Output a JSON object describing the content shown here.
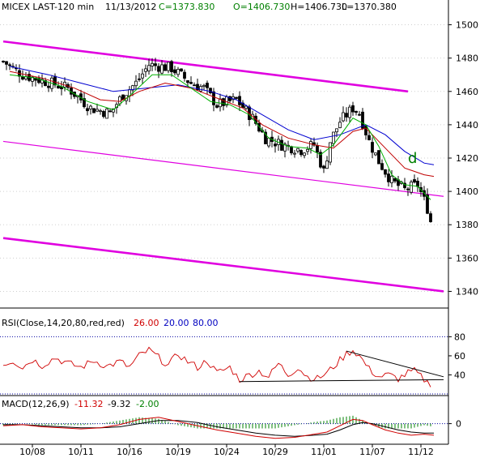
{
  "header": {
    "symbol": "MICEX LAST-120 min",
    "date": "11/13/2012",
    "close": "C=1373.830",
    "open": "O=1406.730",
    "high": "H=1406.730",
    "low": "L=1370.380"
  },
  "annotation_letter": "d",
  "rsi_header": {
    "label": "RSI(Close,14,20,80,red,red)",
    "value": "26.00",
    "lower": "20.00",
    "upper": "80.00"
  },
  "macd_header": {
    "label": "MACD(12,26,9)",
    "macd": "-11.32",
    "signal": "-9.32",
    "hist": "-2.00"
  },
  "colors": {
    "up_candle": "#ffffff",
    "down_candle": "#000000",
    "ma_fast": "#00b000",
    "ma_mid": "#c00000",
    "ma_slow": "#0000d0",
    "channel": "#e000e0",
    "rsi_line": "#d00000",
    "rsi_value": "#d00000",
    "rsi_lower": "#0000c0",
    "rsi_upper": "#0000c0",
    "macd_value": "#d00000",
    "signal_value": "#000000",
    "hist_value": "#008000",
    "grid_dots": "#0000a0",
    "annotation": "#008000"
  },
  "chart_data": [
    {
      "type": "candlestick",
      "panel": "price",
      "x_tick_labels": [
        "10/08",
        "10/11",
        "10/16",
        "10/19",
        "10/24",
        "10/29",
        "11/01",
        "11/07",
        "11/12"
      ],
      "y_tick_labels": [
        "1500",
        "1480",
        "1460",
        "1440",
        "1420",
        "1400",
        "1380",
        "1360",
        "1340"
      ],
      "ylim": [
        1330,
        1510
      ],
      "n_bars": 133,
      "close_path": [
        [
          0,
          1478
        ],
        [
          6,
          1470
        ],
        [
          13,
          1466
        ],
        [
          20,
          1462
        ],
        [
          27,
          1450
        ],
        [
          33,
          1447
        ],
        [
          37,
          1458
        ],
        [
          41,
          1465
        ],
        [
          45,
          1476
        ],
        [
          52,
          1474
        ],
        [
          58,
          1465
        ],
        [
          62,
          1462
        ],
        [
          66,
          1452
        ],
        [
          72,
          1455
        ],
        [
          77,
          1444
        ],
        [
          81,
          1432
        ],
        [
          86,
          1428
        ],
        [
          92,
          1425
        ],
        [
          96,
          1428
        ],
        [
          99,
          1412
        ],
        [
          101,
          1430
        ],
        [
          104,
          1442
        ],
        [
          108,
          1450
        ],
        [
          110,
          1447
        ],
        [
          113,
          1430
        ],
        [
          116,
          1418
        ],
        [
          120,
          1406
        ],
        [
          124,
          1401
        ],
        [
          128,
          1404
        ],
        [
          131,
          1390
        ],
        [
          133,
          1374
        ]
      ],
      "ma_fast_path": [
        [
          2,
          1470
        ],
        [
          10,
          1468
        ],
        [
          18,
          1463
        ],
        [
          26,
          1454
        ],
        [
          34,
          1449
        ],
        [
          40,
          1459
        ],
        [
          46,
          1470
        ],
        [
          52,
          1470
        ],
        [
          58,
          1462
        ],
        [
          64,
          1454
        ],
        [
          70,
          1452
        ],
        [
          76,
          1446
        ],
        [
          82,
          1432
        ],
        [
          88,
          1427
        ],
        [
          94,
          1426
        ],
        [
          98,
          1422
        ],
        [
          102,
          1428
        ],
        [
          108,
          1444
        ],
        [
          112,
          1440
        ],
        [
          116,
          1427
        ],
        [
          120,
          1410
        ],
        [
          124,
          1404
        ],
        [
          128,
          1403
        ],
        [
          132,
          1395
        ]
      ],
      "ma_mid_path": [
        [
          2,
          1472
        ],
        [
          12,
          1468
        ],
        [
          22,
          1462
        ],
        [
          30,
          1455
        ],
        [
          36,
          1454
        ],
        [
          42,
          1460
        ],
        [
          50,
          1465
        ],
        [
          58,
          1462
        ],
        [
          66,
          1456
        ],
        [
          74,
          1450
        ],
        [
          80,
          1440
        ],
        [
          88,
          1432
        ],
        [
          96,
          1428
        ],
        [
          102,
          1426
        ],
        [
          108,
          1436
        ],
        [
          112,
          1438
        ],
        [
          118,
          1426
        ],
        [
          124,
          1414
        ],
        [
          130,
          1410
        ],
        [
          133,
          1409
        ]
      ],
      "ma_slow_path": [
        [
          2,
          1475
        ],
        [
          14,
          1470
        ],
        [
          24,
          1465
        ],
        [
          34,
          1460
        ],
        [
          44,
          1462
        ],
        [
          54,
          1464
        ],
        [
          64,
          1460
        ],
        [
          72,
          1455
        ],
        [
          80,
          1446
        ],
        [
          88,
          1437
        ],
        [
          96,
          1431
        ],
        [
          104,
          1434
        ],
        [
          112,
          1440
        ],
        [
          118,
          1434
        ],
        [
          124,
          1424
        ],
        [
          130,
          1417
        ],
        [
          133,
          1416
        ]
      ],
      "channel_lines": [
        [
          [
            0,
            1490
          ],
          [
            125,
            1460
          ]
        ],
        [
          [
            0,
            1430
          ],
          [
            136,
            1397
          ]
        ],
        [
          [
            0,
            1372
          ],
          [
            136,
            1340
          ]
        ]
      ]
    },
    {
      "type": "line",
      "panel": "rsi",
      "y_tick_labels": [
        "80",
        "60",
        "40"
      ],
      "ylim": [
        20,
        88
      ],
      "reference_levels": [
        20,
        80
      ],
      "rsi_path": [
        [
          0,
          51
        ],
        [
          3,
          55
        ],
        [
          6,
          48
        ],
        [
          9,
          56
        ],
        [
          12,
          50
        ],
        [
          16,
          58
        ],
        [
          20,
          52
        ],
        [
          24,
          48
        ],
        [
          28,
          55
        ],
        [
          32,
          49
        ],
        [
          36,
          54
        ],
        [
          39,
          48
        ],
        [
          42,
          60
        ],
        [
          45,
          66
        ],
        [
          48,
          58
        ],
        [
          51,
          50
        ],
        [
          54,
          62
        ],
        [
          57,
          54
        ],
        [
          60,
          48
        ],
        [
          63,
          55
        ],
        [
          66,
          42
        ],
        [
          70,
          48
        ],
        [
          73,
          35
        ],
        [
          76,
          40
        ],
        [
          79,
          44
        ],
        [
          82,
          38
        ],
        [
          85,
          52
        ],
        [
          88,
          40
        ],
        [
          91,
          48
        ],
        [
          94,
          38
        ],
        [
          97,
          36
        ],
        [
          100,
          42
        ],
        [
          103,
          52
        ],
        [
          106,
          62
        ],
        [
          108,
          66
        ],
        [
          110,
          60
        ],
        [
          113,
          46
        ],
        [
          116,
          38
        ],
        [
          119,
          40
        ],
        [
          122,
          36
        ],
        [
          125,
          42
        ],
        [
          127,
          44
        ],
        [
          129,
          38
        ],
        [
          131,
          32
        ],
        [
          133,
          30
        ]
      ],
      "trend_lines": [
        [
          [
            73,
            33
          ],
          [
            136,
            35
          ]
        ],
        [
          [
            106,
            65
          ],
          [
            136,
            38
          ]
        ]
      ]
    },
    {
      "type": "line",
      "panel": "macd",
      "y_tick_labels": [
        "0"
      ],
      "ylim": [
        -18,
        12
      ],
      "macd_path": [
        [
          0,
          -2
        ],
        [
          6,
          -1
        ],
        [
          12,
          -3
        ],
        [
          18,
          -4
        ],
        [
          24,
          -5
        ],
        [
          30,
          -4
        ],
        [
          36,
          -1
        ],
        [
          42,
          4
        ],
        [
          48,
          6
        ],
        [
          54,
          2
        ],
        [
          60,
          -2
        ],
        [
          66,
          -6
        ],
        [
          72,
          -9
        ],
        [
          78,
          -12
        ],
        [
          84,
          -14
        ],
        [
          90,
          -13
        ],
        [
          96,
          -10
        ],
        [
          100,
          -8
        ],
        [
          104,
          -2
        ],
        [
          108,
          4
        ],
        [
          111,
          3
        ],
        [
          114,
          -1
        ],
        [
          118,
          -6
        ],
        [
          122,
          -9
        ],
        [
          126,
          -11
        ],
        [
          130,
          -10
        ],
        [
          133,
          -11
        ]
      ],
      "signal_path": [
        [
          0,
          -1
        ],
        [
          6,
          -1
        ],
        [
          12,
          -2
        ],
        [
          18,
          -3
        ],
        [
          24,
          -4
        ],
        [
          30,
          -4
        ],
        [
          36,
          -3
        ],
        [
          42,
          0
        ],
        [
          48,
          3
        ],
        [
          54,
          3
        ],
        [
          60,
          1
        ],
        [
          66,
          -3
        ],
        [
          72,
          -6
        ],
        [
          78,
          -9
        ],
        [
          84,
          -11
        ],
        [
          90,
          -12
        ],
        [
          96,
          -11
        ],
        [
          100,
          -10
        ],
        [
          104,
          -6
        ],
        [
          108,
          -1
        ],
        [
          111,
          1
        ],
        [
          114,
          0
        ],
        [
          118,
          -3
        ],
        [
          122,
          -6
        ],
        [
          126,
          -8
        ],
        [
          130,
          -9
        ],
        [
          133,
          -9
        ]
      ]
    }
  ]
}
